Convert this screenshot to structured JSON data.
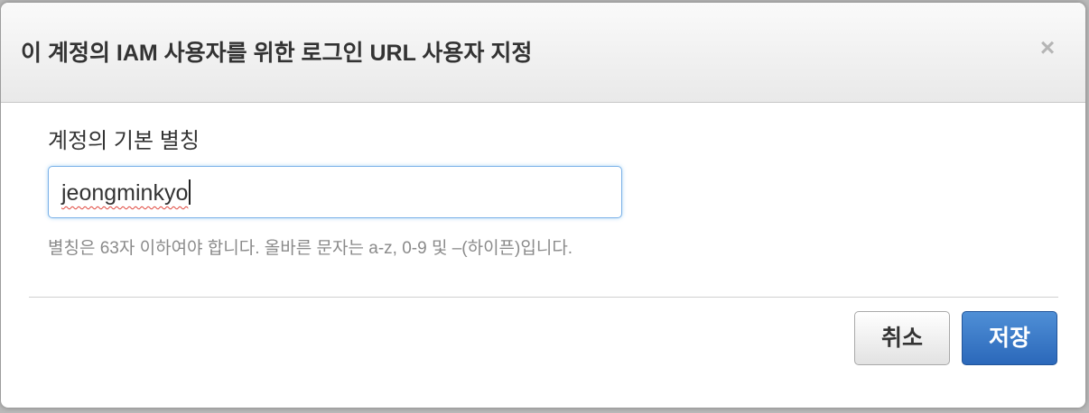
{
  "dialog": {
    "title": "이 계정의 IAM 사용자를 위한 로그인 URL 사용자 지정",
    "close_icon": "close-icon",
    "close_glyph": "×"
  },
  "alias_field": {
    "label": "계정의 기본 별칭",
    "value": "jeongminkyo",
    "help": "별칭은 63자 이하여야 합니다. 올바른 문자는 a-z, 0-9 및 –(하이픈)입니다."
  },
  "actions": {
    "cancel_label": "취소",
    "save_label": "저장"
  },
  "colors": {
    "primary": "#2b68ba",
    "input_focus": "#7ab1e8",
    "spellcheck": "#e0453b"
  }
}
